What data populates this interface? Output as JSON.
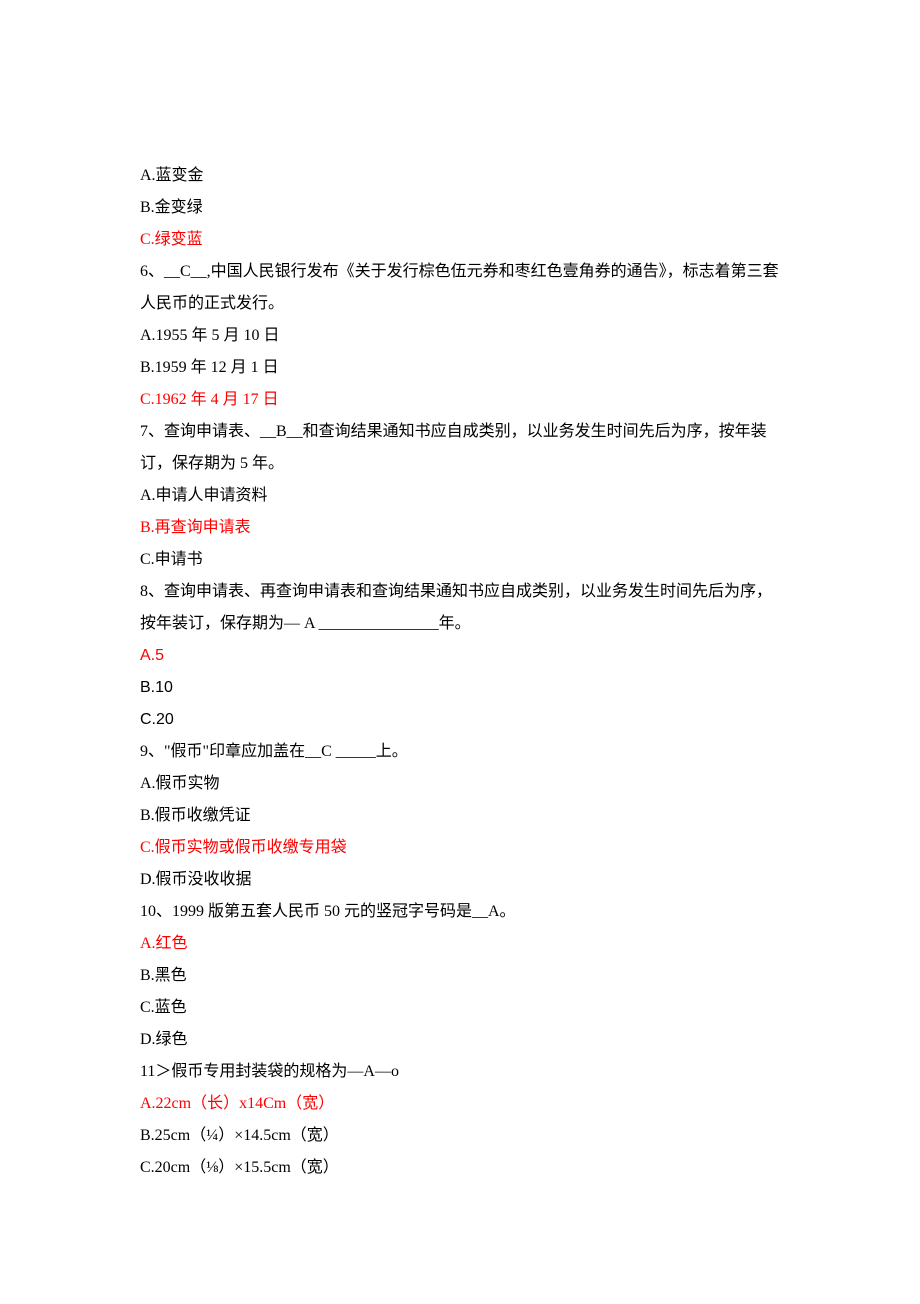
{
  "lines": [
    {
      "text": "A.蓝变金",
      "red": false
    },
    {
      "text": "B.金变绿",
      "red": false
    },
    {
      "text": "C.绿变蓝",
      "red": true
    },
    {
      "text": "6、__C__,中国人民银行发布《关于发行棕色伍元券和枣红色壹角券的通告》，标志着第三套人民币的正式发行。",
      "red": false
    },
    {
      "text": "A.1955 年 5 月 10 日",
      "red": false
    },
    {
      "text": "B.1959 年 12 月 1 日",
      "red": false
    },
    {
      "text": "C.1962 年 4 月 17 日",
      "red": true
    },
    {
      "text": "7、查询申请表、__B__和查询结果通知书应自成类别，以业务发生时间先后为序，按年装订，保存期为 5 年。",
      "red": false
    },
    {
      "text": "A.申请人申请资料",
      "red": false
    },
    {
      "text": "B.再查询申请表",
      "red": true
    },
    {
      "text": "C.申请书",
      "red": false
    },
    {
      "text": "8、查询申请表、再查询申请表和查询结果通知书应自成类别，以业务发生时间先后为序，按年装订，保存期为— A _______________年。",
      "red": false
    },
    {
      "text": "A.5",
      "red": true
    },
    {
      "text": "B.10",
      "red": false
    },
    {
      "text": "C.20",
      "red": false
    },
    {
      "text": "9、\"假币\"印章应加盖在__C _____上。",
      "red": false
    },
    {
      "text": "A.假币实物",
      "red": false
    },
    {
      "text": "B.假币收缴凭证",
      "red": false
    },
    {
      "text": "C.假币实物或假币收缴专用袋",
      "red": true
    },
    {
      "text": "D.假币没收收据",
      "red": false
    },
    {
      "text": "10、1999 版第五套人民币 50 元的竖冠字号码是__A。",
      "red": false
    },
    {
      "text": "A.红色",
      "red": true
    },
    {
      "text": "B.黑色",
      "red": false
    },
    {
      "text": "C.蓝色",
      "red": false
    },
    {
      "text": "D.绿色",
      "red": false
    },
    {
      "text": "11＞假币专用封装袋的规格为—A—o",
      "red": false
    },
    {
      "text": "A.22cm（长）x14Cm（宽）",
      "red": true
    },
    {
      "text": "B.25cm（¼）×14.5cm（宽）",
      "red": false
    },
    {
      "text": "C.20cm（⅛）×15.5cm（宽）",
      "red": false
    }
  ]
}
